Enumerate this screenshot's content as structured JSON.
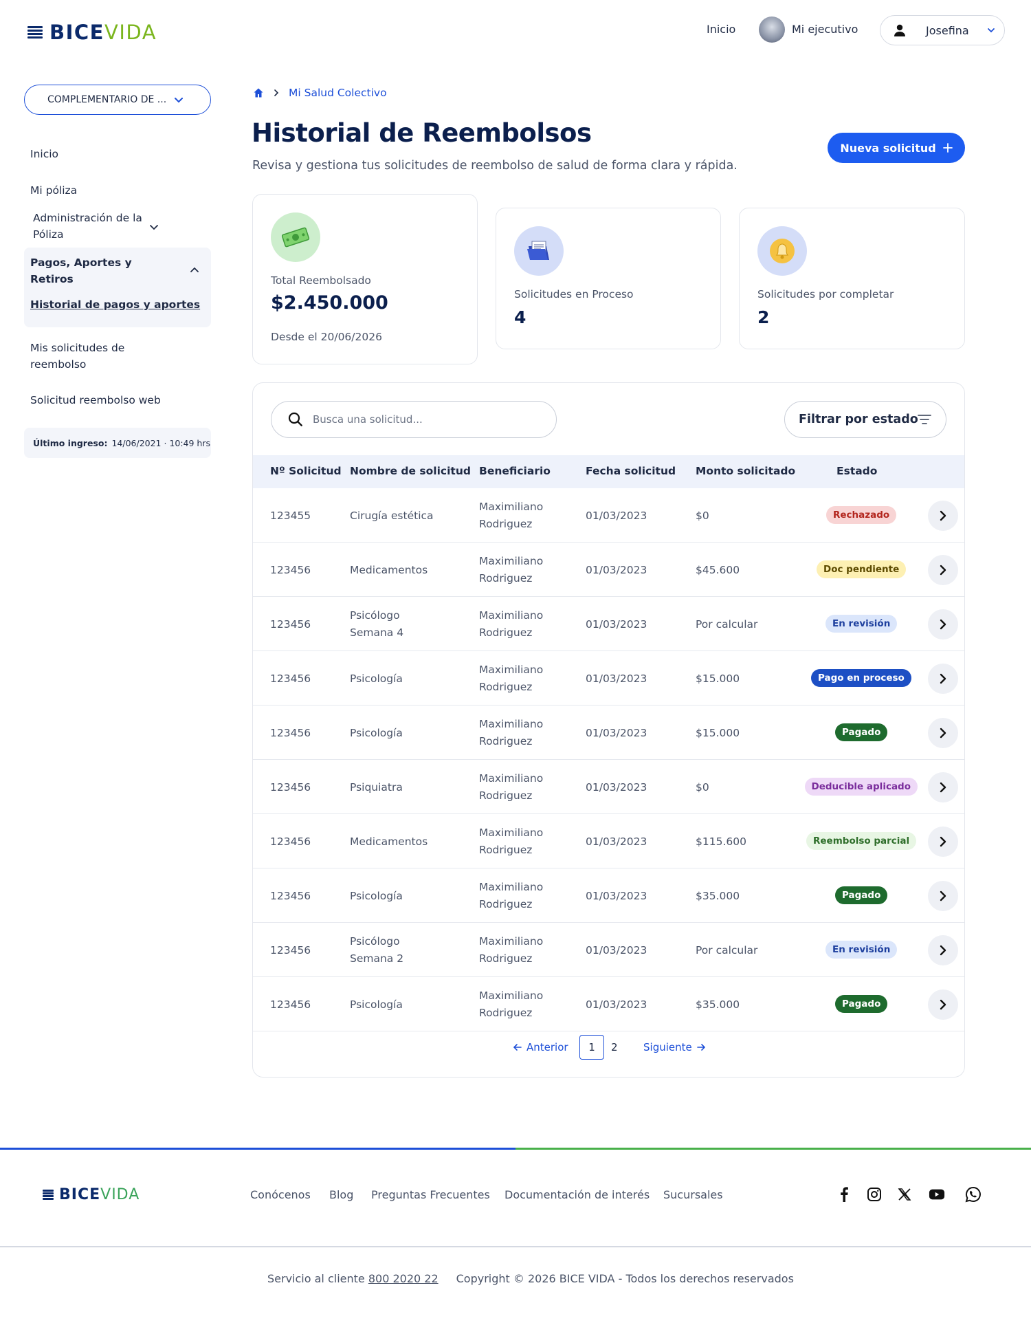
{
  "header": {
    "logo": {
      "bice": "BICE",
      "vida": "VIDA"
    },
    "nav_inicio": "Inicio",
    "nav_ejecutivo": "Mi ejecutivo",
    "user_name": "Josefina"
  },
  "sidebar": {
    "plan_select": "COMPLEMENTARIO DE ...",
    "items": [
      {
        "label": "Inicio"
      },
      {
        "label": "Mi póliza"
      },
      {
        "label": "Administración de la Póliza"
      },
      {
        "label": "Pagos, Aportes y Retiros"
      },
      {
        "label": "Historial de pagos y aportes"
      },
      {
        "label": "Mis solicitudes de reembolso"
      },
      {
        "label": "Solicitud reembolso web"
      }
    ],
    "last_login_label": "Último ingreso:",
    "last_login_value": "14/06/2021 · 10:49 hrs"
  },
  "breadcrumb": {
    "current": "Mi Salud Colectivo"
  },
  "page": {
    "title": "Historial de Reembolsos",
    "subtitle": "Revisa y gestiona tus solicitudes de reembolso de salud de forma clara y rápida.",
    "new_button": "Nueva solicitud"
  },
  "summary": {
    "total": {
      "label": "Total Reembolsado",
      "value": "$2.450.000",
      "foot": "Desde el 20/06/2026"
    },
    "in_process": {
      "label": "Solicitudes en Proceso",
      "value": "4"
    },
    "to_complete": {
      "label": "Solicitudes por completar",
      "value": "2"
    }
  },
  "table": {
    "search_placeholder": "Busca una solicitud...",
    "filter_label": "Filtrar por estado",
    "columns": [
      "Nº Solicitud",
      "Nombre de solicitud",
      "Beneficiario",
      "Fecha solicitud",
      "Monto solicitado",
      "Estado"
    ],
    "rows": [
      {
        "id": "123455",
        "name1": "Cirugía estética",
        "name2": "",
        "ben1": "Maximiliano",
        "ben2": "Rodriguez",
        "date": "01/03/2023",
        "amount": "$0",
        "status": "Rechazado"
      },
      {
        "id": "123456",
        "name1": "Medicamentos",
        "name2": "",
        "ben1": "Maximiliano",
        "ben2": "Rodriguez",
        "date": "01/03/2023",
        "amount": "$45.600",
        "status": "Doc pendiente"
      },
      {
        "id": "123456",
        "name1": "Psicólogo",
        "name2": "Semana 4",
        "ben1": "Maximiliano",
        "ben2": "Rodriguez",
        "date": "01/03/2023",
        "amount": "Por calcular",
        "status": "En revisión"
      },
      {
        "id": "123456",
        "name1": "Psicología",
        "name2": "",
        "ben1": "Maximiliano",
        "ben2": "Rodriguez",
        "date": "01/03/2023",
        "amount": "$15.000",
        "status": "Pago en proceso"
      },
      {
        "id": "123456",
        "name1": "Psicología",
        "name2": "",
        "ben1": "Maximiliano",
        "ben2": "Rodriguez",
        "date": "01/03/2023",
        "amount": "$15.000",
        "status": "Pagado"
      },
      {
        "id": "123456",
        "name1": "Psiquiatra",
        "name2": "",
        "ben1": "Maximiliano",
        "ben2": "Rodriguez",
        "date": "01/03/2023",
        "amount": "$0",
        "status": "Deducible aplicado"
      },
      {
        "id": "123456",
        "name1": "Medicamentos",
        "name2": "",
        "ben1": "Maximiliano",
        "ben2": "Rodriguez",
        "date": "01/03/2023",
        "amount": "$115.600",
        "status": "Reembolso parcial"
      },
      {
        "id": "123456",
        "name1": "Psicología",
        "name2": "",
        "ben1": "Maximiliano",
        "ben2": "Rodriguez",
        "date": "01/03/2023",
        "amount": "$35.000",
        "status": "Pagado"
      },
      {
        "id": "123456",
        "name1": "Psicólogo",
        "name2": "Semana 2",
        "ben1": "Maximiliano",
        "ben2": "Rodriguez",
        "date": "01/03/2023",
        "amount": "Por calcular",
        "status": "En revisión"
      },
      {
        "id": "123456",
        "name1": "Psicología",
        "name2": "",
        "ben1": "Maximiliano",
        "ben2": "Rodriguez",
        "date": "01/03/2023",
        "amount": "$35.000",
        "status": "Pagado"
      }
    ],
    "status_colors": {
      "Rechazado": {
        "bg": "#f8d4d4",
        "fg": "#b3261e"
      },
      "Doc pendiente": {
        "bg": "#fdf0b3",
        "fg": "#5c4a00"
      },
      "En revisión": {
        "bg": "#dbe6fb",
        "fg": "#1d3f9e"
      },
      "Pago en proceso": {
        "bg": "#1d4fc4",
        "fg": "#ffffff"
      },
      "Pagado": {
        "bg": "#1e6b2e",
        "fg": "#ffffff"
      },
      "Deducible aplicado": {
        "bg": "#eed9f7",
        "fg": "#7a2d9c"
      },
      "Reembolso parcial": {
        "bg": "#e8f6e4",
        "fg": "#2e6e2a"
      }
    }
  },
  "pagination": {
    "prev": "Anterior",
    "page1": "1",
    "page2": "2",
    "next": "Siguiente"
  },
  "footer": {
    "links": [
      "Conócenos",
      "Blog",
      "Preguntas Frecuentes",
      "Documentación de interés",
      "Sucursales"
    ],
    "service_label": "Servicio al cliente",
    "service_phone": "800 2020 22",
    "copyright": "Copyright © 2026 BICE VIDA - Todos los derechos reservados"
  },
  "icons": [
    "menu-icon",
    "user-icon",
    "chevron-down-icon",
    "home-icon",
    "chevron-right-icon",
    "plus-icon",
    "money-icon",
    "document-icon",
    "bell-icon",
    "search-icon",
    "filter-icon",
    "arrow-left-icon",
    "arrow-right-icon",
    "facebook-icon",
    "instagram-icon",
    "x-icon",
    "youtube-icon",
    "whatsapp-icon"
  ],
  "colors": {
    "primary": "#1d5cf0",
    "navy": "#0b2a6b",
    "green": "#7ab51d"
  }
}
